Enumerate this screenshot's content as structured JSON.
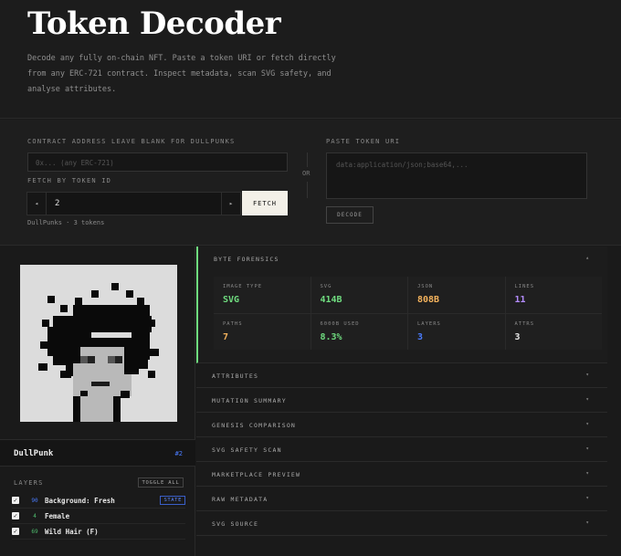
{
  "hero": {
    "title": "Token Decoder",
    "description": "Decode any fully on-chain NFT. Paste a token URI or fetch directly from any ERC-721 contract. Inspect metadata, scan SVG safety, and analyse attributes."
  },
  "form": {
    "contract_label": "CONTRACT ADDRESS  LEAVE BLANK FOR DULLPUNKS",
    "contract_placeholder": "0x... (any ERC-721)",
    "fetch_by_id_label": "FETCH BY TOKEN ID",
    "prev_symbol": "◂",
    "next_symbol": "▸",
    "token_id": "2",
    "fetch_label": "FETCH",
    "or_label": "OR",
    "paste_label": "PASTE TOKEN URI",
    "paste_placeholder": "data:application/json;base64,...",
    "decode_label": "DECODE",
    "collection_note": "DullPunks · 3 tokens"
  },
  "token": {
    "name": "DullPunk",
    "id": "#2",
    "layers_label": "LAYERS",
    "toggle_all_label": "TOGGLE ALL",
    "layers": [
      {
        "count": "90",
        "name": "Background: Fresh",
        "badge": "STATE",
        "checked": true
      },
      {
        "count": "4",
        "name": "Female",
        "badge": "",
        "checked": true
      },
      {
        "count": "69",
        "name": "Wild Hair (F)",
        "badge": "",
        "checked": true
      }
    ]
  },
  "sections": {
    "byte_forensics": "BYTE FORENSICS",
    "byte_forensics_chev": "▴",
    "collapsed": [
      {
        "label": "ATTRIBUTES",
        "chev": "▾"
      },
      {
        "label": "MUTATION SUMMARY",
        "chev": "▾"
      },
      {
        "label": "GENESIS COMPARISON",
        "chev": "▾"
      },
      {
        "label": "SVG SAFETY SCAN",
        "chev": "▾"
      },
      {
        "label": "MARKETPLACE PREVIEW",
        "chev": "▾"
      },
      {
        "label": "RAW METADATA",
        "chev": "▾"
      },
      {
        "label": "SVG SOURCE",
        "chev": "▾"
      }
    ]
  },
  "stats": [
    {
      "label": "IMAGE TYPE",
      "value": "SVG",
      "color": "#6fdc7f"
    },
    {
      "label": "SVG",
      "value": "414B",
      "color": "#6fdc7f"
    },
    {
      "label": "JSON",
      "value": "808B",
      "color": "#f3b25c"
    },
    {
      "label": "LINES",
      "value": "11",
      "color": "#b48cff"
    },
    {
      "label": "PATHS",
      "value": "7",
      "color": "#f3b25c"
    },
    {
      "label": "6000B USED",
      "value": "8.3%",
      "color": "#6fdc7f"
    },
    {
      "label": "LAYERS",
      "value": "3",
      "color": "#4a7cff"
    },
    {
      "label": "ATTRS",
      "value": "3",
      "color": "#e8e8e8"
    }
  ],
  "colors": {
    "accent": "#6fdc7f",
    "id_blue": "#4a7cff",
    "bg": "#1a1a1a"
  }
}
